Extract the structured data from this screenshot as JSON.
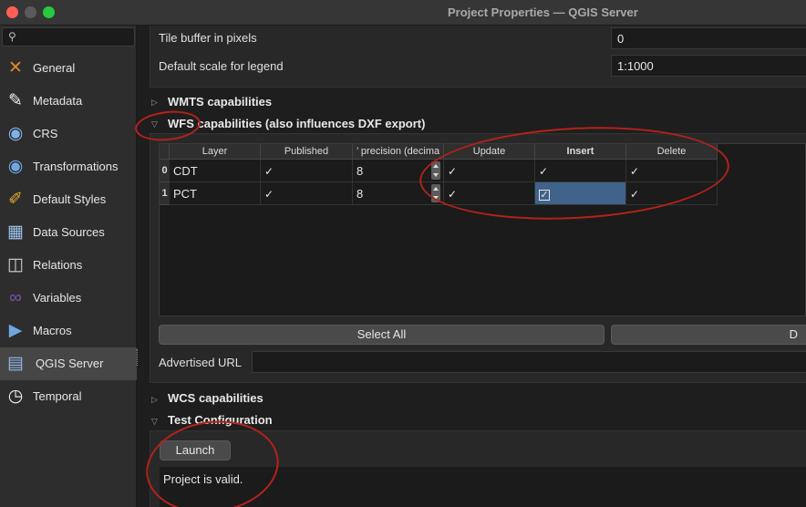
{
  "window": {
    "title": "Project Properties — QGIS Server"
  },
  "sidebar": {
    "search_placeholder": "",
    "items": [
      {
        "label": "General",
        "icon": "general-tools-icon"
      },
      {
        "label": "Metadata",
        "icon": "metadata-icon"
      },
      {
        "label": "CRS",
        "icon": "crs-globe-icon"
      },
      {
        "label": "Transformations",
        "icon": "transformations-globe-icon"
      },
      {
        "label": "Default Styles",
        "icon": "default-styles-brush-icon"
      },
      {
        "label": "Data Sources",
        "icon": "data-sources-icon"
      },
      {
        "label": "Relations",
        "icon": "relations-icon"
      },
      {
        "label": "Variables",
        "icon": "variables-icon"
      },
      {
        "label": "Macros",
        "icon": "macros-icon"
      },
      {
        "label": "QGIS Server",
        "icon": "qgis-server-icon",
        "selected": true
      },
      {
        "label": "Temporal",
        "icon": "temporal-clock-icon"
      }
    ]
  },
  "wms": {
    "tile_buffer_label": "Tile buffer in pixels",
    "tile_buffer_value": "0",
    "legend_scale_label": "Default scale for legend",
    "legend_scale_value": "1:1000"
  },
  "wmts": {
    "title": "WMTS capabilities"
  },
  "wfs": {
    "title": "WFS capabilities (also influences DXF export)",
    "columns": [
      "Layer",
      "Published",
      "’ precision (decima",
      "Update",
      "Insert",
      "Delete"
    ],
    "rows": [
      {
        "index": "0",
        "layer": "CDT",
        "published": "✓",
        "precision": "8",
        "update": "✓",
        "insert": "✓",
        "delete": "✓"
      },
      {
        "index": "1",
        "layer": "PCT",
        "published": "✓",
        "precision": "8",
        "update": "✓",
        "insert": "✓",
        "delete": "✓"
      }
    ],
    "select_all": "Select All",
    "deselect_all_visible": "D",
    "advertised_url_label": "Advertised URL",
    "advertised_url_value": ""
  },
  "wcs": {
    "title": "WCS capabilities"
  },
  "test": {
    "title": "Test Configuration",
    "launch": "Launch",
    "result": "Project is valid."
  },
  "colors": {
    "accent": "#3f638b",
    "annotation": "#b3221b"
  }
}
